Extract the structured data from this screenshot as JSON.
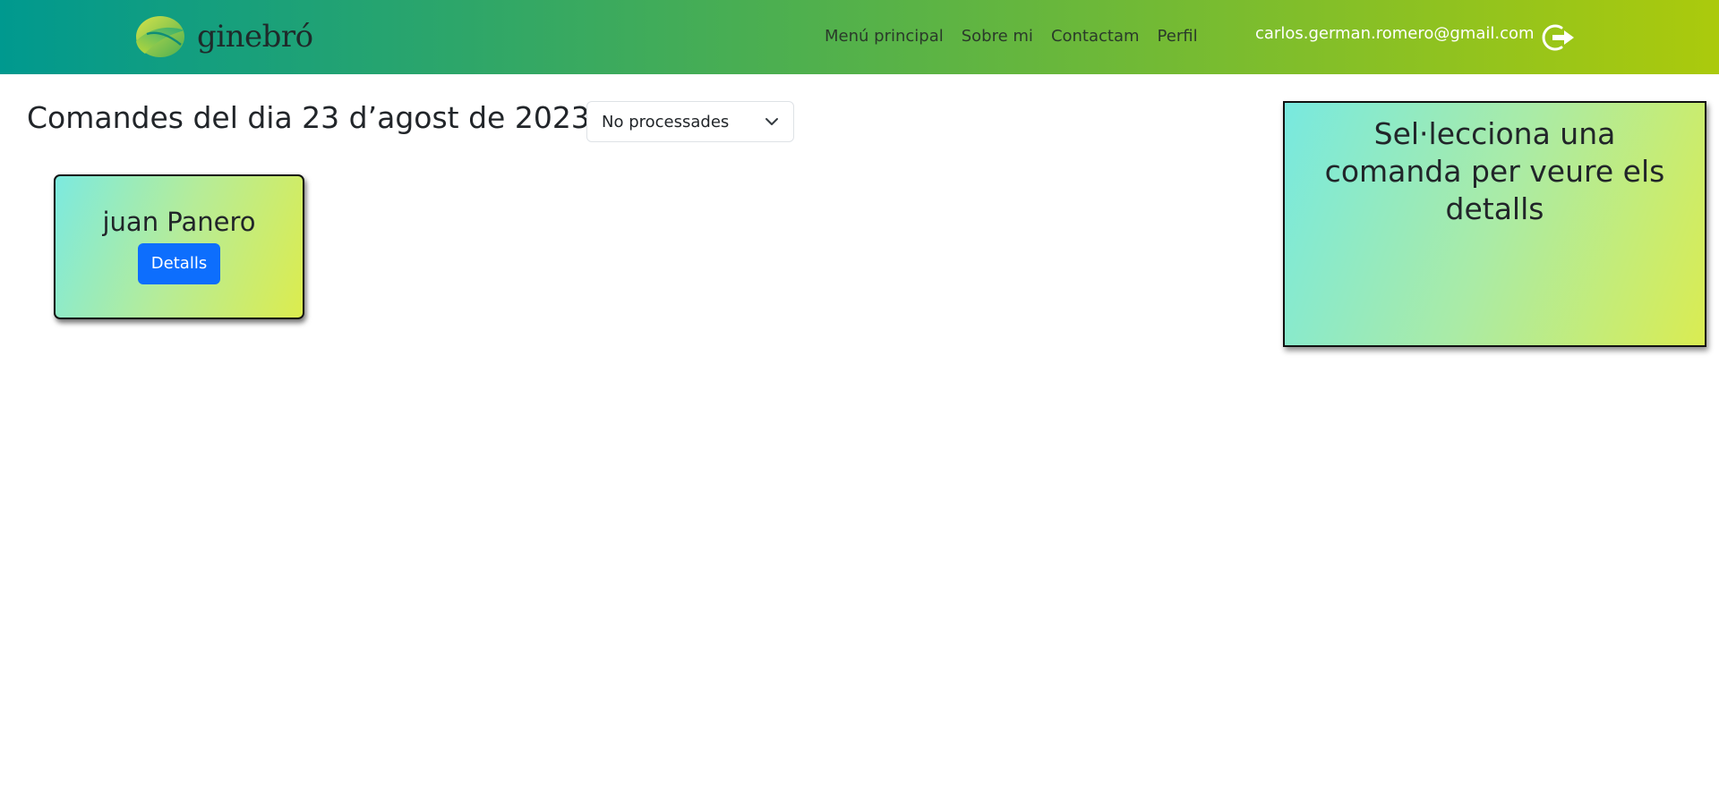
{
  "navbar": {
    "brand": "ginebró",
    "links": [
      {
        "label": "Menú principal"
      },
      {
        "label": "Sobre mi"
      },
      {
        "label": "Contactam"
      },
      {
        "label": "Perfil"
      }
    ],
    "user_email": "carlos.german.romero@gmail.com",
    "logout_icon": "logout-icon",
    "colors": {
      "gradient_start": "#00998f",
      "gradient_mid": "#4caf50",
      "gradient_end": "#abca0c"
    }
  },
  "main": {
    "title": "Comandes del dia 23 d’agost de 2023",
    "filter": {
      "selected": "No processades",
      "icon": "chevron-down-icon"
    },
    "orders": [
      {
        "customer": "juan Panero",
        "button_label": "Detalls"
      }
    ]
  },
  "detail_panel": {
    "prompt": "Sel·lecciona una comanda per veure els detalls"
  },
  "colors": {
    "primary_button": "#0d6efd",
    "card_gradient_start": "#7ceadf",
    "card_gradient_end": "#dcec4e"
  }
}
